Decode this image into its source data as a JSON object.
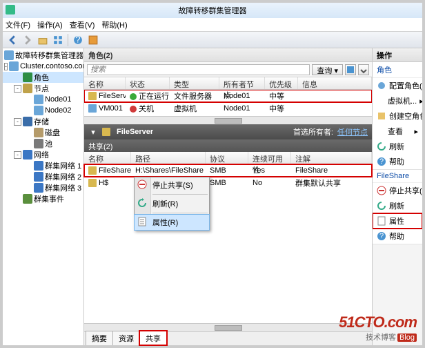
{
  "window": {
    "title": "故障转移群集管理器"
  },
  "menu": {
    "file": "文件(F)",
    "action": "操作(A)",
    "view": "查看(V)",
    "help": "帮助(H)"
  },
  "tree": {
    "root": "故障转移群集管理器",
    "cluster": "Cluster.contoso.com",
    "roles": "角色",
    "nodes": "节点",
    "node1": "Node01",
    "node2": "Node02",
    "storage": "存储",
    "disks": "磁盘",
    "pools": "池",
    "networks": "网络",
    "net1": "群集网络 1",
    "net2": "群集网络 2",
    "net3": "群集网络 3",
    "events": "群集事件"
  },
  "roles_section": {
    "title": "角色(2)",
    "search_placeholder": "搜索",
    "query_btn": "查询",
    "cols": {
      "name": "名称",
      "status": "状态",
      "type": "类型",
      "owner": "所有者节点",
      "priority": "优先级",
      "info": "信息"
    },
    "rows": [
      {
        "name": "FileServer",
        "status": "正在运行",
        "status_kind": "up",
        "type": "文件服务器",
        "owner": "Node01",
        "priority": "中等"
      },
      {
        "name": "VM001",
        "status": "关机",
        "status_kind": "down",
        "type": "虚拟机",
        "owner": "Node01",
        "priority": "中等"
      }
    ]
  },
  "detail": {
    "name": "FileServer",
    "pref_owner_label": "首选所有者:",
    "pref_owner_link": "任何节点",
    "shares_title": "共享(2)",
    "cols": {
      "name": "名称",
      "path": "路径",
      "proto": "协议",
      "avail": "连续可用性",
      "note": "注解"
    },
    "rows": [
      {
        "name": "FileShare",
        "path": "H:\\Shares\\FileShare",
        "proto": "SMB",
        "avail": "Yes",
        "note": "FileShare"
      },
      {
        "name": "H$",
        "path": "",
        "proto": "SMB",
        "avail": "No",
        "note": "群集默认共享"
      }
    ]
  },
  "context_menu": {
    "stop": "停止共享(S)",
    "refresh": "刷新(R)",
    "properties": "属性(R)"
  },
  "tabs": {
    "summary": "摘要",
    "resource": "资源",
    "share": "共享"
  },
  "actions": {
    "header": "操作",
    "group_roles": "角色",
    "configure_role": "配置角色(R)...",
    "vm": "虚拟机...",
    "create_empty": "创建空角色(E)",
    "view": "查看",
    "refresh": "刷新",
    "help": "帮助",
    "group_fs": "FileShare",
    "stop_share": "停止共享(R)",
    "refresh2": "刷新",
    "properties": "属性",
    "help2": "帮助"
  },
  "brand": {
    "logo": "51CTO.com",
    "sub": "技术博客",
    "tag": "Blog"
  }
}
